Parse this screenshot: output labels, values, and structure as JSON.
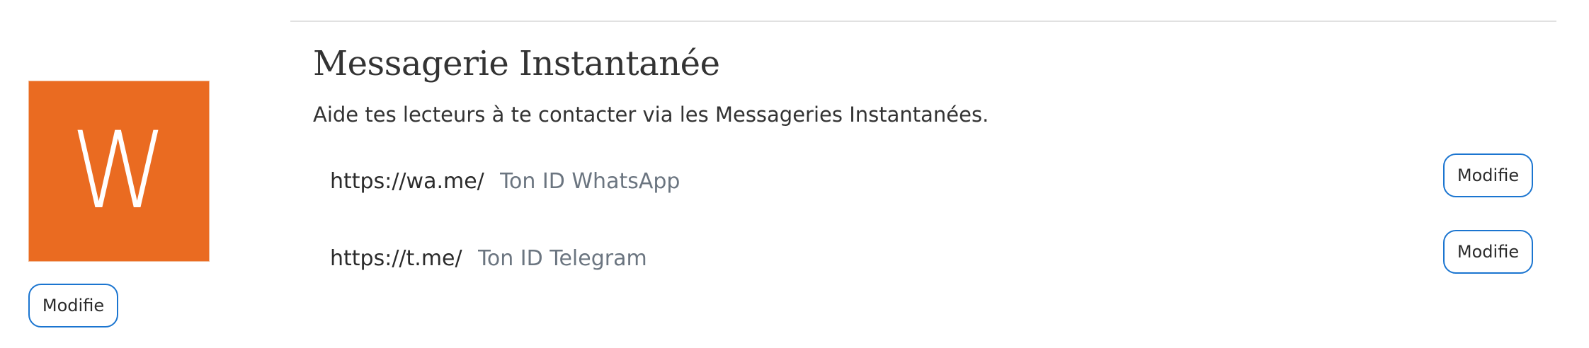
{
  "avatar": {
    "letter": "W",
    "background_color": "#ea6b21",
    "edit_label": "Modifie"
  },
  "section": {
    "title": "Messagerie Instantanée",
    "description": "Aide tes lecteurs à te contacter via les Messageries Instantanées."
  },
  "messengers": [
    {
      "prefix": "https://wa.me/",
      "value": "",
      "placeholder": "Ton ID WhatsApp",
      "edit_label": "Modifie"
    },
    {
      "prefix": "https://t.me/",
      "value": "",
      "placeholder": "Ton ID Telegram",
      "edit_label": "Modifie"
    }
  ],
  "colors": {
    "accent": "#1b75d0",
    "text": "#2b2b2b",
    "placeholder": "#6b7580",
    "divider": "#e1e1e1"
  }
}
